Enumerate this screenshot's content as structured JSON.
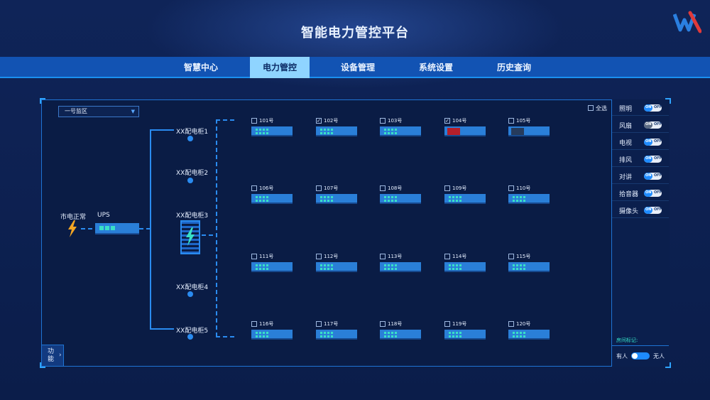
{
  "header": {
    "title": "智能电力管控平台"
  },
  "nav": {
    "tabs": [
      {
        "label": "智慧中心"
      },
      {
        "label": "电力管控",
        "active": true
      },
      {
        "label": "设备管理"
      },
      {
        "label": "系统设置"
      },
      {
        "label": "历史查询"
      }
    ]
  },
  "zone_select": {
    "value": "一号监区"
  },
  "power": {
    "mains_label": "市电正常",
    "ups_label": "UPS",
    "cabinets": [
      {
        "label": "XX配电柜1"
      },
      {
        "label": "XX配电柜2"
      },
      {
        "label": "XX配电柜3"
      },
      {
        "label": "XX配电柜4"
      },
      {
        "label": "XX配电柜5"
      }
    ]
  },
  "select_all": {
    "label": "全选",
    "checked": false
  },
  "rooms": [
    {
      "label": "101号",
      "checked": false,
      "status": "normal"
    },
    {
      "label": "102号",
      "checked": true,
      "status": "normal"
    },
    {
      "label": "103号",
      "checked": false,
      "status": "normal"
    },
    {
      "label": "104号",
      "checked": true,
      "status": "alarm"
    },
    {
      "label": "105号",
      "checked": false,
      "status": "off"
    },
    {
      "label": "106号",
      "checked": false,
      "status": "normal"
    },
    {
      "label": "107号",
      "checked": false,
      "status": "normal"
    },
    {
      "label": "108号",
      "checked": false,
      "status": "normal"
    },
    {
      "label": "109号",
      "checked": false,
      "status": "normal"
    },
    {
      "label": "110号",
      "checked": false,
      "status": "normal"
    },
    {
      "label": "111号",
      "checked": false,
      "status": "normal"
    },
    {
      "label": "112号",
      "checked": false,
      "status": "normal"
    },
    {
      "label": "113号",
      "checked": false,
      "status": "normal"
    },
    {
      "label": "114号",
      "checked": false,
      "status": "normal"
    },
    {
      "label": "115号",
      "checked": false,
      "status": "normal"
    },
    {
      "label": "116号",
      "checked": false,
      "status": "normal"
    },
    {
      "label": "117号",
      "checked": false,
      "status": "normal"
    },
    {
      "label": "118号",
      "checked": false,
      "status": "normal"
    },
    {
      "label": "119号",
      "checked": false,
      "status": "normal"
    },
    {
      "label": "120号",
      "checked": false,
      "status": "normal"
    }
  ],
  "controls": {
    "on_text": "ON",
    "off_text": "OFF",
    "items": [
      {
        "label": "照明",
        "state": "on"
      },
      {
        "label": "风扇",
        "state": "off"
      },
      {
        "label": "电视",
        "state": "on"
      },
      {
        "label": "排风",
        "state": "on"
      },
      {
        "label": "对讲",
        "state": "on"
      },
      {
        "label": "拾音器",
        "state": "on"
      },
      {
        "label": "摄像头",
        "state": "on"
      }
    ]
  },
  "room_mark": {
    "label": "房间标记:",
    "occupied_label": "有人",
    "vacant_label": "无人"
  },
  "function_button": {
    "label": "功能"
  },
  "colors": {
    "background": "#0d1f4f",
    "accent": "#2a8bf0",
    "active_tab": "#8fd4ff",
    "indicator": "#39e0c6",
    "alarm": "#b41f2a",
    "bolt": "#f5a623"
  }
}
